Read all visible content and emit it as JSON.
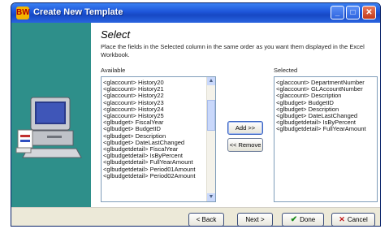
{
  "window": {
    "title": "Create New Template",
    "icon_text": "BW"
  },
  "titlebar_buttons": {
    "minimize": "_",
    "maximize": "□",
    "close": "✕"
  },
  "content": {
    "heading": "Select",
    "instructions": "Place the fields in the Selected column in the same order as you want them displayed in the Excel Workbook.",
    "available_label": "Available",
    "selected_label": "Selected"
  },
  "available": [
    "<glaccount>  History20",
    "<glaccount>  History21",
    "<glaccount>  History22",
    "<glaccount>  History23",
    "<glaccount>  History24",
    "<glaccount>  History25",
    "<glbudget>  FiscalYear",
    "<glbudget>  BudgetID",
    "<glbudget>  Description",
    "<glbudget>  DateLastChanged",
    "<glbudgetdetail>  FiscalYear",
    "<glbudgetdetail>  IsByPercent",
    "<glbudgetdetail>  FullYearAmount",
    "<glbudgetdetail>  Period01Amount",
    "<glbudgetdetail>  Period02Amount"
  ],
  "selected": [
    "<glaccount>  DepartmentNumber",
    "<glaccount>  GLAccountNumber",
    "<glaccount>  Description",
    "<glbudget>  BudgetID",
    "<glbudget>  Description",
    "<glbudget>  DateLastChanged",
    "<glbudgetdetail>  IsByPercent",
    "<glbudgetdetail>  FullYearAmount"
  ],
  "buttons": {
    "add": "Add >>",
    "remove": "<< Remove",
    "back": "< Back",
    "next": "Next >",
    "done": "Done",
    "cancel": "Cancel"
  },
  "colors": {
    "left_pane": "#2e8f8a",
    "titlebar": "#1d55d8"
  }
}
